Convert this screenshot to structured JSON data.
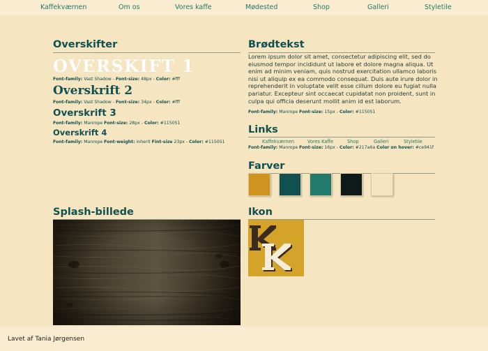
{
  "nav": {
    "items": [
      "Kaffekværnen",
      "Om os",
      "Vores kaffe",
      "Mødested",
      "Shop",
      "Galleri",
      "Styletile"
    ]
  },
  "headings": {
    "title": "Overskifter",
    "h1_sample": "OVERSKIFT 1",
    "h1_spec_family_label": "Font-family:",
    "h1_spec": " Vast Shadow - ",
    "h1_spec_size_label": "Font-size:",
    "h1_spec_size": " 48px - ",
    "h1_spec_color_label": "Color:",
    "h1_spec_color": " #fff",
    "h2_sample": "Overskrift 2",
    "h2_spec_family_label": "Font-family:",
    "h2_spec": " Vast Shadow - ",
    "h2_spec_size_label": "Font-size:",
    "h2_spec_size": " 34px - ",
    "h2_spec_color_label": "Color:",
    "h2_spec_color": " #fff",
    "h3_sample": "Overskrift 3",
    "h3_spec_family_label": "Font-family:",
    "h3_spec": " Manrope ",
    "h3_spec_size_label": "Font-size:",
    "h3_spec_size": " 28px - ",
    "h3_spec_color_label": "Color:",
    "h3_spec_color": " #115051",
    "h4_sample": "Overskrift 4",
    "h4_spec_family_label": "Font-family:",
    "h4_spec": " Manrope ",
    "h4_spec_weight_label": "Font-weight:",
    "h4_spec_weight": " inherit ",
    "h4_spec_size_label": "Fint-size",
    "h4_spec_size": " 23px - ",
    "h4_spec_color_label": "Color:",
    "h4_spec_color": " #115051"
  },
  "body_text": {
    "title": "Brødtekst",
    "paragraph": "Lorem ipsum dolor sit amet, consectetur adipiscing elit, sed do eiusmod tempor incididunt ut labore et dolore magna aliqua. Ut enim ad minim veniam, quis nostrud exercitation ullamco laboris nisi ut aliquip ex ea commodo consequat. Duis aute irure dolor in reprehenderit in voluptate velit esse cillum dolore eu fugiat nulla pariatur. Excepteur sint occaecat cupidatat non proident, sunt in culpa qui officia deserunt mollit anim id est laborum.",
    "spec_family_label": "Font-family:",
    "spec": " Manrope ",
    "spec_size_label": "Font-size:",
    "spec_size": " 15px - ",
    "spec_color_label": "Color:",
    "spec_color": " #115051"
  },
  "links": {
    "title": "Links",
    "items": [
      "Kaffekværnen",
      "Vores Kaffe",
      "Shop",
      "Galleri",
      "Styletile"
    ],
    "spec_family_label": "Font-family:",
    "spec": " Manrope ",
    "spec_size_label": "Font-size:",
    "spec_size": " 16px - ",
    "spec_color_label": "Color:",
    "spec_color": " #217a6a ",
    "spec_hover_label": "Color on hover:",
    "spec_hover": " #ce941f"
  },
  "colors": {
    "title": "Farver",
    "swatches": [
      "#ce941f",
      "#115051",
      "#217a6a",
      "#111a1a",
      "#f4e4c1"
    ]
  },
  "splash": {
    "title": "Splash-billede"
  },
  "icon": {
    "title": "Ikon",
    "letter": "K"
  },
  "footer": {
    "text": "Lavet af Tania Jørgensen"
  },
  "theme": {
    "background": "#f5e5c0",
    "nav_bg": "#f9ecd0",
    "heading": "#115051",
    "link": "#217a6a"
  }
}
